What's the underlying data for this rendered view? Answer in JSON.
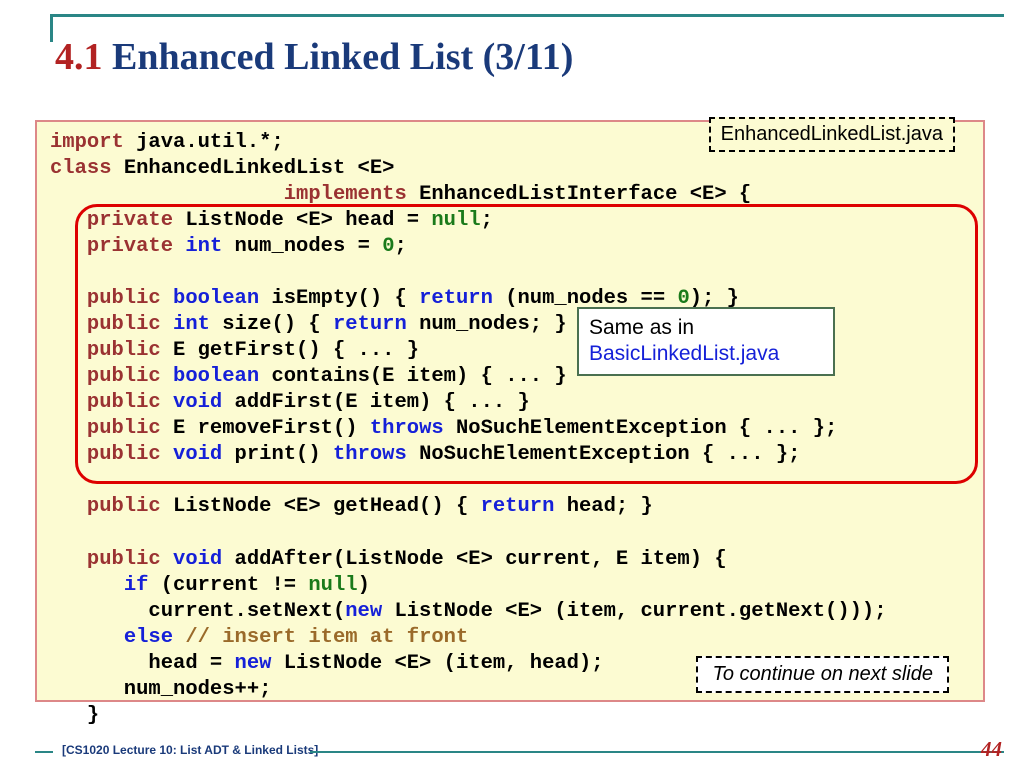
{
  "title": {
    "num": "4.1",
    "text": " Enhanced Linked List (3/11)"
  },
  "file_label": "EnhancedLinkedList.java",
  "annotation": {
    "line1": "Same as in",
    "line2": "BasicLinkedList.java"
  },
  "continue": "To continue on next slide",
  "footer": "[CS1020 Lecture 10: List ADT & Linked Lists]",
  "page": "44",
  "kw": {
    "import": "import",
    "class": "class",
    "implements": "implements",
    "private": "private",
    "public": "public",
    "int": "int",
    "boolean": "boolean",
    "void": "void",
    "return": "return",
    "throws": "throws",
    "null": "null",
    "if": "if",
    "else": "else",
    "new": "new"
  },
  "txt": {
    "javautil": " java.util.*;",
    "classdecl": " EnhancedLinkedList <E>",
    "impl": " EnhancedListInterface <E> {",
    "head_decl_a": " ListNode <E> head = ",
    "head_decl_b": ";",
    "numnodes_a": " num_nodes = ",
    "zero": "0",
    "numnodes_b": ";",
    "isempty_a": " isEmpty() { ",
    "isempty_b": " (num_nodes == ",
    "isempty_c": "); }",
    "size_a": " size() { ",
    "size_b": " num_nodes; }",
    "getfirst": " E getFirst() { ... }",
    "contains_a": " contains(E item) { ... }",
    "addfirst_a": " addFirst(E item) { ... }",
    "removefirst_a": " E removeFirst() ",
    "removefirst_b": " NoSuchElementException { ... };",
    "print_a": " print() ",
    "print_b": " NoSuchElementException { ... };",
    "gethead_a": " ListNode <E> getHead() { ",
    "gethead_b": " head; }",
    "addafter_sig": " addAfter(ListNode <E> current, E item) {",
    "ifcond": " (current != ",
    "ifcond_b": ")",
    "setnext_a": "        current.setNext(",
    "setnext_b": " ListNode <E> (item, current.getNext()));",
    "comment": " // insert item at front",
    "headassign_a": "        head = ",
    "headassign_b": " ListNode <E> (item, head);",
    "inc": "      num_nodes++;",
    "endbrace": "   }"
  }
}
